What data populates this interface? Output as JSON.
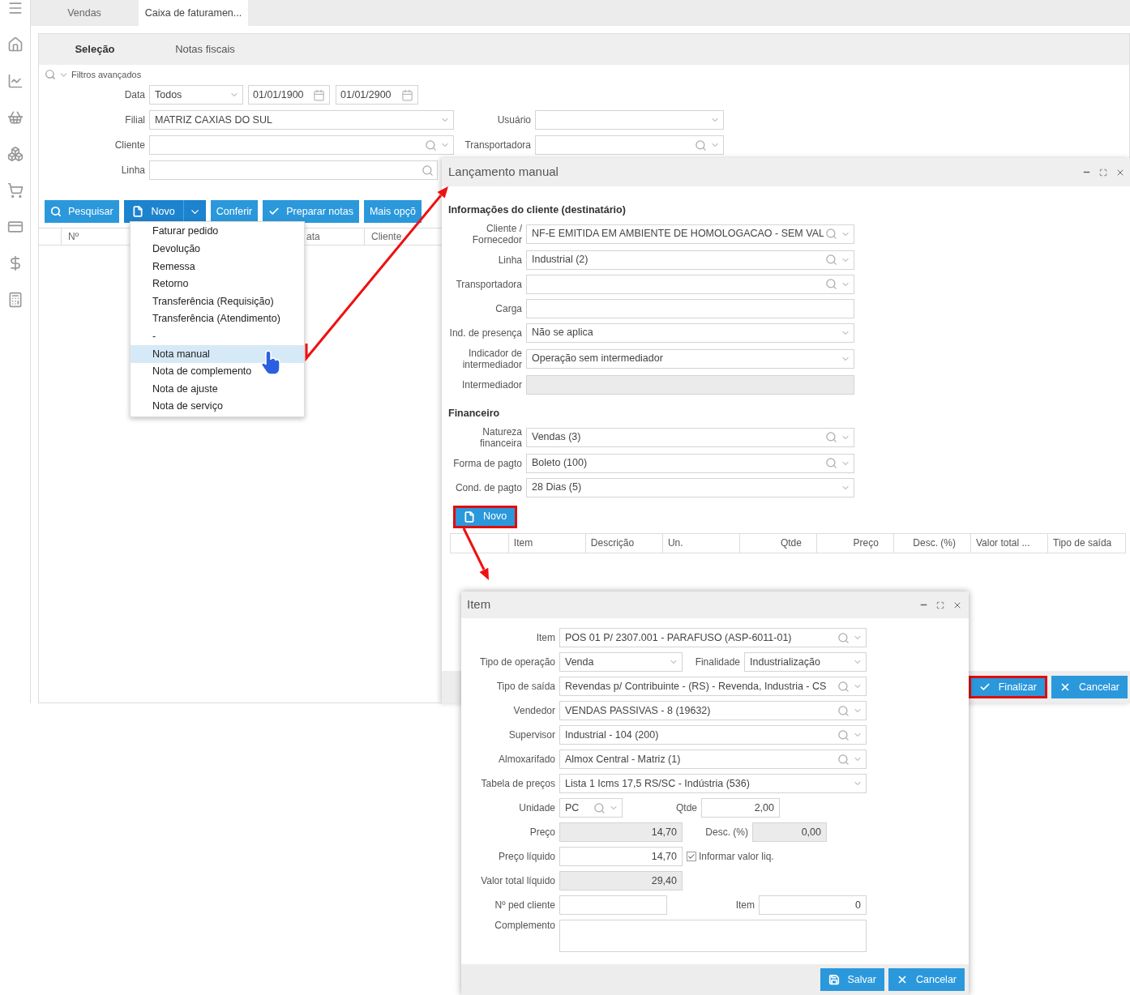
{
  "tabs": [
    {
      "label": "Vendas",
      "selected": false
    },
    {
      "label": "Caixa de faturamen...",
      "selected": true
    }
  ],
  "panel_tabs": [
    {
      "label": "Seleção",
      "selected": true
    },
    {
      "label": "Notas fiscais",
      "selected": false
    }
  ],
  "filters": {
    "toggle": "Filtros avançados",
    "data": {
      "label": "Data",
      "value": "Todos",
      "kind": "select",
      "from": "01/01/1900",
      "to": "01/01/2900"
    },
    "filial": {
      "label": "Filial",
      "value": "MATRIZ CAXIAS DO SUL",
      "kind": "select"
    },
    "usuario": {
      "label": "Usuário",
      "kind": "select"
    },
    "cliente": {
      "label": "Cliente",
      "kind": "lookup"
    },
    "transportadora": {
      "label": "Transportadora",
      "kind": "lookup"
    },
    "linha": {
      "label": "Linha",
      "kind": "search"
    }
  },
  "toolbar": [
    {
      "label": "Pesquisar",
      "kind": "search"
    },
    {
      "label": "Novo",
      "kind": "file",
      "dropdown": true
    },
    {
      "label": "Conferir"
    },
    {
      "label": "Preparar notas",
      "kind": "check"
    },
    {
      "label": "Mais opçõ"
    }
  ],
  "table_columns": [
    "Nº",
    "ata",
    "Cliente"
  ],
  "new_menu": [
    {
      "label": "Faturar pedido",
      "selected": false
    },
    {
      "label": "Devolução",
      "selected": false
    },
    {
      "label": "Remessa",
      "selected": false
    },
    {
      "label": "Retorno",
      "selected": false
    },
    {
      "label": "Transferência (Requisição)",
      "selected": false
    },
    {
      "label": "Transferência (Atendimento)",
      "selected": false
    },
    {
      "label": "-",
      "selected": false
    },
    {
      "label": "Nota manual",
      "selected": true
    },
    {
      "label": "Nota de complemento",
      "selected": false
    },
    {
      "label": "Nota de ajuste",
      "selected": false
    },
    {
      "label": "Nota de serviço",
      "selected": false
    }
  ],
  "manual_dialog": {
    "title": "Lançamento manual",
    "sections": [
      {
        "heading": "Informações do cliente (destinatário)",
        "fields": [
          {
            "label": "Cliente / Fornecedor",
            "value": "NF-E EMITIDA EM AMBIENTE DE HOMOLOGACAO - SEM VAL",
            "kind": "lookup"
          },
          {
            "label": "Linha",
            "value": "Industrial (2)",
            "kind": "lookup"
          },
          {
            "label": "Transportadora",
            "kind": "lookup"
          },
          {
            "label": "Carga",
            "kind": "text"
          },
          {
            "label": "Ind. de presença",
            "value": "Não se aplica",
            "kind": "select"
          },
          {
            "label": "Indicador de intermediador",
            "value": "Operação sem intermediador",
            "kind": "select"
          },
          {
            "label": "Intermediador",
            "kind": "disabled"
          }
        ]
      },
      {
        "heading": "Financeiro",
        "fields": [
          {
            "label": "Natureza financeira",
            "value": "Vendas (3)",
            "kind": "lookup"
          },
          {
            "label": "Forma de pagto",
            "value": "Boleto (100)",
            "kind": "lookup"
          },
          {
            "label": "Cond. de pagto",
            "value": "28 Dias (5)",
            "kind": "select"
          }
        ]
      }
    ],
    "new_button": {
      "label": "Novo",
      "kind": "file",
      "highlighted": true
    },
    "columns": [
      "Item",
      "Descrição",
      "Un.",
      "Qtde",
      "Preço",
      "Desc. (%)",
      "Valor total ...",
      "Tipo de saída"
    ],
    "actions": [
      {
        "label": "Finalizar",
        "kind": "check",
        "highlighted": true
      },
      {
        "label": "Cancelar",
        "kind": "x",
        "highlighted": false
      }
    ]
  },
  "item_dialog": {
    "title": "Item",
    "item": {
      "label": "Item",
      "value": "POS 01 P/ 2307.001 - PARAFUSO (ASP-6011-01)",
      "kind": "lookup"
    },
    "tipo_operacao": {
      "label": "Tipo de operação",
      "value": "Venda",
      "kind": "select"
    },
    "finalidade": {
      "label": "Finalidade",
      "value": "Industrialização",
      "kind": "select"
    },
    "tipo_saida": {
      "label": "Tipo de saída",
      "value": "Revendas p/ Contribuinte - (RS) - Revenda, Industria - CS",
      "kind": "lookup"
    },
    "vendedor": {
      "label": "Vendedor",
      "value": "VENDAS PASSIVAS - 8 (19632)",
      "kind": "lookup"
    },
    "supervisor": {
      "label": "Supervisor",
      "value": "Industrial - 104 (200)",
      "kind": "lookup"
    },
    "almoxarifado": {
      "label": "Almoxarifado",
      "value": "Almox Central - Matriz (1)",
      "kind": "lookup"
    },
    "tabela_precos": {
      "label": "Tabela de preços",
      "value": "Lista 1 Icms 17,5 RS/SC - Indústria (536)",
      "kind": "select"
    },
    "unidade": {
      "label": "Unidade",
      "value": "PC",
      "kind": "lookup"
    },
    "qtde": {
      "label": "Qtde",
      "value": "2,00",
      "kind": "text"
    },
    "preco": {
      "label": "Preço",
      "value": "14,70",
      "kind": "disabled"
    },
    "desconto": {
      "label": "Desc. (%)",
      "value": "0,00",
      "kind": "disabled"
    },
    "preco_liquido": {
      "label": "Preço líquido",
      "value": "14,70",
      "kind": "text"
    },
    "informar_valor_liq": {
      "label": "Informar valor liq.",
      "checked": true
    },
    "valor_total": {
      "label": "Valor total líquido",
      "value": "29,40",
      "kind": "disabled"
    },
    "ped_cliente": {
      "label": "Nº ped cliente",
      "kind": "text"
    },
    "item_numero": {
      "label": "Item",
      "value": "0",
      "kind": "text"
    },
    "complemento": {
      "label": "Complemento",
      "kind": "textarea"
    },
    "actions": [
      {
        "label": "Salvar",
        "kind": "save"
      },
      {
        "label": "Cancelar",
        "kind": "x"
      }
    ]
  }
}
